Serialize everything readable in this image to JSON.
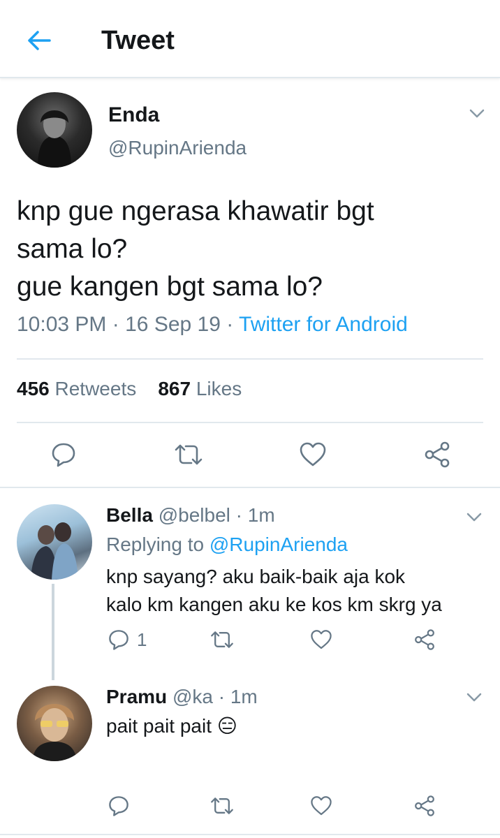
{
  "header": {
    "title": "Tweet",
    "back_icon": "arrow-left-icon"
  },
  "tweet": {
    "author_name": "Enda",
    "author_handle": "@RupinArienda",
    "text_lines": [
      "knp gue ngerasa khawatir bgt",
      "sama lo?",
      "gue kangen bgt sama lo?"
    ],
    "time": "10:03 PM",
    "date": "16 Sep 19",
    "separator": "·",
    "source": "Twitter for Android",
    "retweets_count": "456",
    "retweets_label": "Retweets",
    "likes_count": "867",
    "likes_label": "Likes"
  },
  "replies": [
    {
      "name": "Bella",
      "handle": "@belbel",
      "time": "1m",
      "replying_prefix": "Replying to",
      "replying_to": "@RupinArienda",
      "text_lines": [
        "knp sayang? aku baik-baik aja kok",
        "kalo km kangen aku ke kos km skrg ya"
      ],
      "reply_count": "1"
    },
    {
      "name": "Pramu",
      "handle": "@ka",
      "time": "1m",
      "text_lines": [
        "pait pait pait 😑"
      ]
    }
  ],
  "colors": {
    "accent": "#1da1f2",
    "text_primary": "#14171a",
    "text_secondary": "#657786",
    "divider": "#e1e8ed"
  }
}
